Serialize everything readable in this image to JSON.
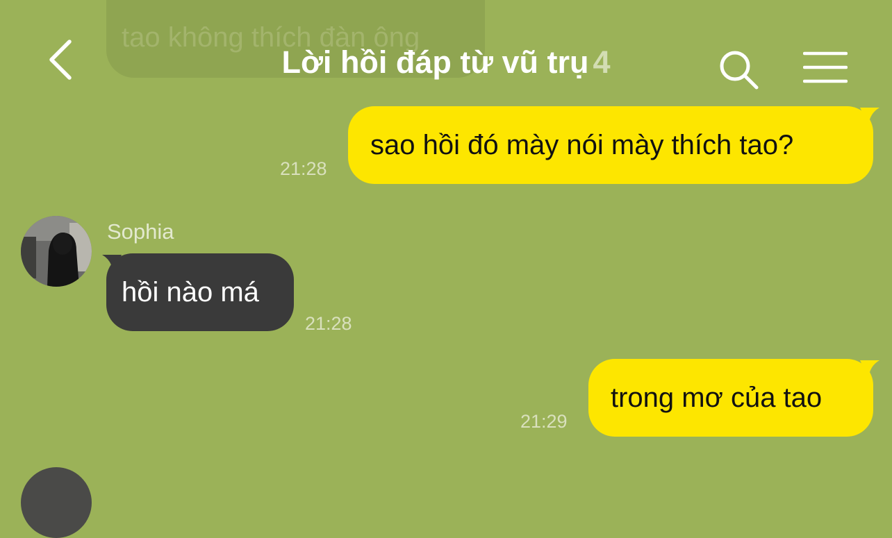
{
  "header": {
    "title": "Lời hồi đáp từ vũ trụ",
    "member_count": "4",
    "back_icon": "chevron-left-icon",
    "search_icon": "search-icon",
    "menu_icon": "hamburger-menu-icon"
  },
  "messages": [
    {
      "direction": "incoming",
      "text": "tao không thích đàn ông",
      "faded": true
    },
    {
      "direction": "outgoing",
      "text": "sao hồi đó mày nói mày thích tao?",
      "time": "21:28"
    },
    {
      "direction": "incoming",
      "sender": "Sophia",
      "text": "hồi nào má",
      "time": "21:28"
    },
    {
      "direction": "outgoing",
      "text": "trong mơ của tao",
      "time": "21:29"
    }
  ],
  "colors": {
    "background": "#9bb258",
    "outgoing_bubble": "#fde600",
    "incoming_bubble": "#3a3a3a"
  }
}
